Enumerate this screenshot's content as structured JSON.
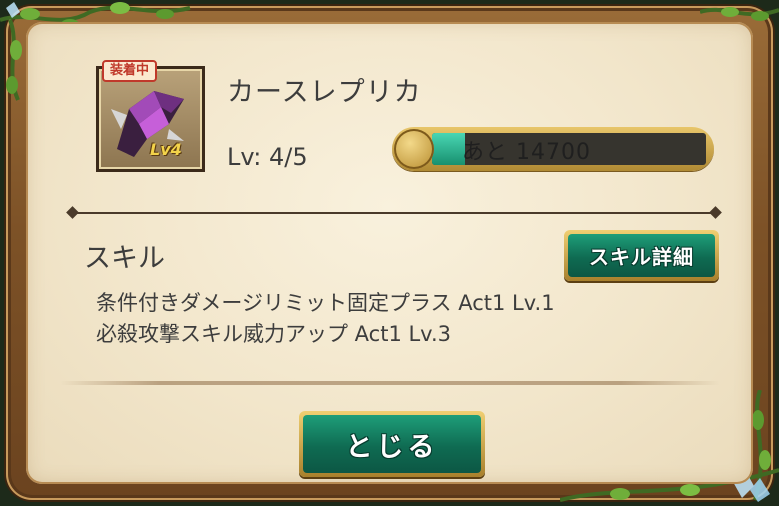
{
  "equip": {
    "status_badge": "装着中",
    "name": "カースレプリカ",
    "level_text": "Lv: 4/5",
    "level_badge": "Lv4",
    "exp_remaining_label": "あと 14700",
    "exp_progress": 0.12
  },
  "skills": {
    "title": "スキル",
    "detail_button_label": "スキル詳細",
    "lines": [
      "条件付きダメージリミット固定プラス Act1 Lv.1",
      "必殺攻撃スキル威力アップ Act1 Lv.3"
    ]
  },
  "close_button_label": "とじる",
  "colors": {
    "button_green": "#0f6b52",
    "exp_fill": "#18906f",
    "badge_red": "#c0392b",
    "panel_bg": "#f2e6cb"
  },
  "icons": [
    "weapon-icon",
    "exp-knob-icon",
    "vine-decoration-icon"
  ]
}
